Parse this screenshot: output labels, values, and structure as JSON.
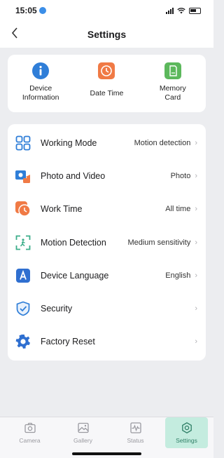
{
  "status_bar": {
    "time": "15:05"
  },
  "nav": {
    "title": "Settings",
    "back_icon": "chevron-left-icon"
  },
  "quick_actions": [
    {
      "label": "Device\nInformation",
      "icon": "info-icon",
      "color": "#2f7ed8"
    },
    {
      "label": "Date Time",
      "icon": "clock-icon",
      "color": "#f07a45"
    },
    {
      "label": "Memory\nCard",
      "icon": "sd-card-icon",
      "color": "#5cb85c"
    }
  ],
  "settings": [
    {
      "label": "Working Mode",
      "value": "Motion detection",
      "icon": "grid-icon"
    },
    {
      "label": "Photo and Video",
      "value": "Photo",
      "icon": "camera-icon"
    },
    {
      "label": "Work Time",
      "value": "All time",
      "icon": "timer-icon"
    },
    {
      "label": "Motion Detection",
      "value": "Medium sensitivity",
      "icon": "motion-scan-icon"
    },
    {
      "label": "Device Language",
      "value": "English",
      "icon": "language-icon"
    },
    {
      "label": "Security",
      "value": "",
      "icon": "shield-icon"
    },
    {
      "label": "Factory Reset",
      "value": "",
      "icon": "reset-gear-icon"
    }
  ],
  "chevron": "›",
  "tabs": [
    {
      "label": "Camera",
      "icon": "camera-tab-icon",
      "active": false
    },
    {
      "label": "Gallery",
      "icon": "gallery-icon",
      "active": false
    },
    {
      "label": "Status",
      "icon": "status-wave-icon",
      "active": false
    },
    {
      "label": "Settings",
      "icon": "settings-hex-icon",
      "active": true
    }
  ],
  "colors": {
    "accent_active_tab": "#c4ecdf",
    "icon_blue": "#2f7ed8",
    "icon_orange": "#f07a45",
    "icon_green": "#5cb85c"
  }
}
